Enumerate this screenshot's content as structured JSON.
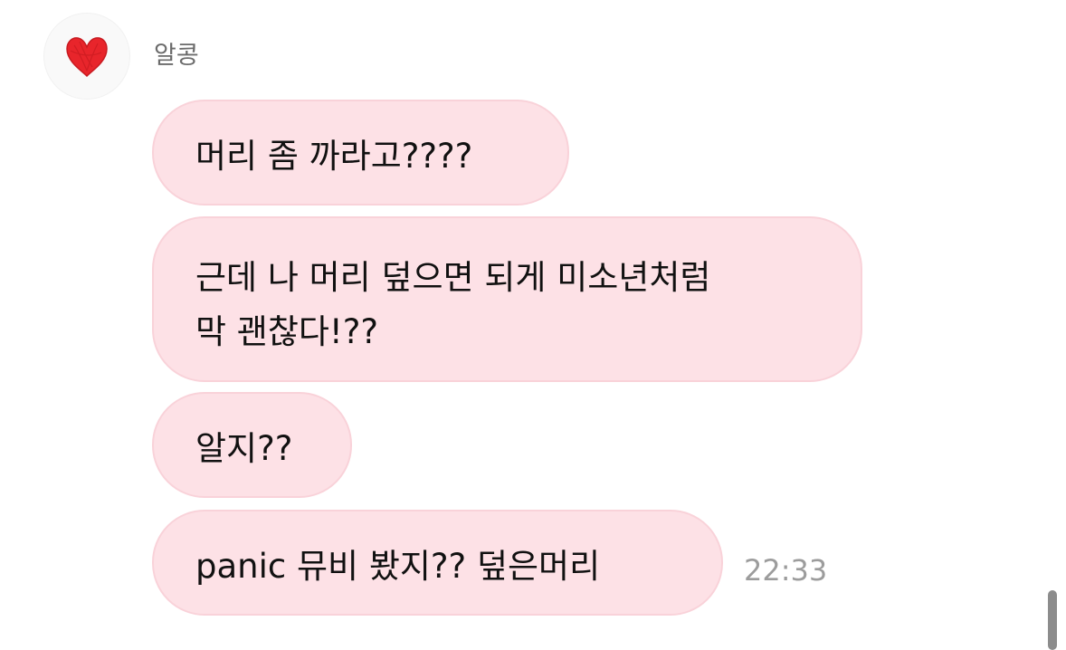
{
  "sender": {
    "name": "알콩",
    "avatar_icon": "red-heart-icon",
    "avatar_color": "#e8252b"
  },
  "messages": [
    {
      "text": "머리 좀 까라고????"
    },
    {
      "lines": [
        "근데 나 머리 덮으면 되게 미소년처럼",
        "막 괜찮다!??"
      ]
    },
    {
      "text": "알지??"
    },
    {
      "text": "panic 뮤비 봤지?? 덮은머리"
    }
  ],
  "timestamp": "22:33",
  "colors": {
    "bubble_fill": "#fde1e6",
    "bubble_border": "#f9d2d9",
    "name_text": "#6b6b6b",
    "time_text": "#9c9c9c"
  }
}
